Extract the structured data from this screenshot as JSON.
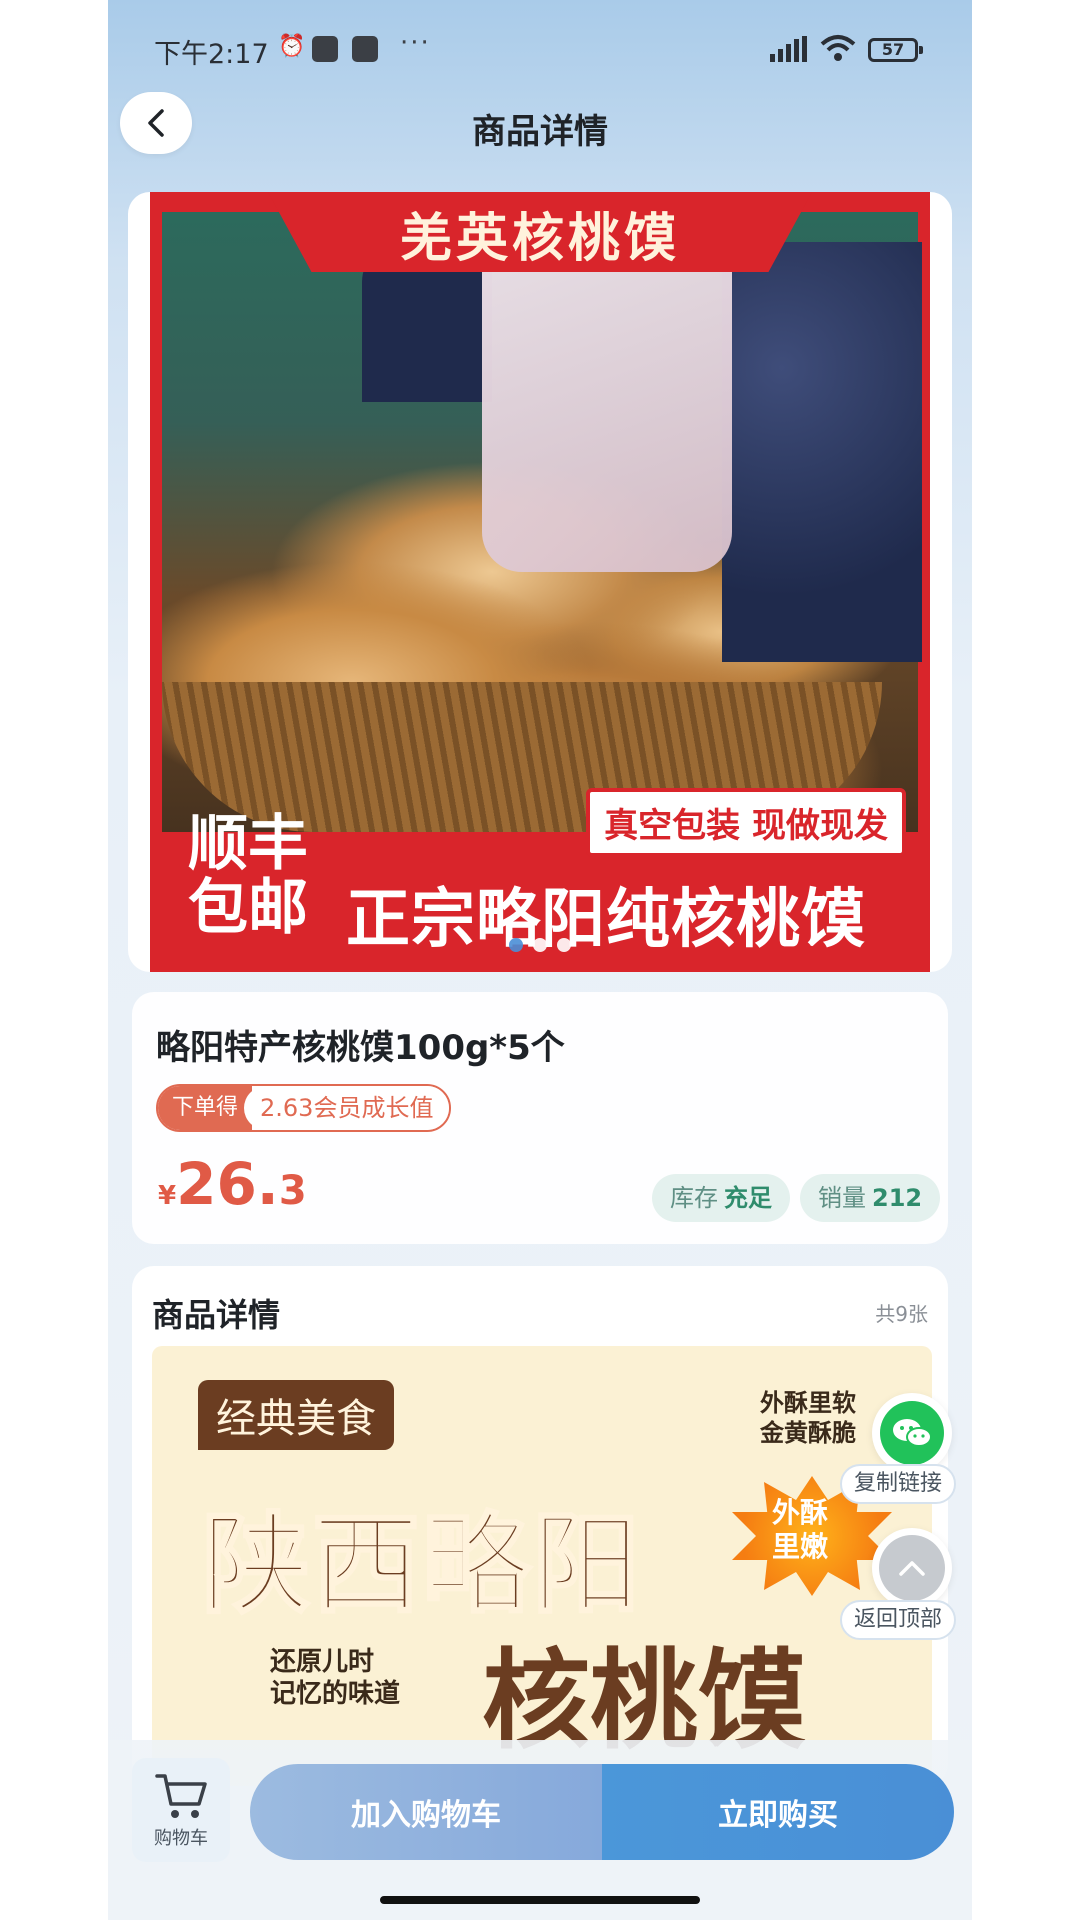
{
  "status_bar": {
    "time": "下午2:17",
    "battery": "57",
    "more": "···"
  },
  "header": {
    "title": "商品详情"
  },
  "hero": {
    "title": "羌英核桃馍",
    "tag": "真空包装 现做现发",
    "shipping": "顺丰包邮",
    "slogan": "正宗略阳纯核桃馍",
    "slide_count": 3,
    "active_slide": 1
  },
  "product": {
    "name": "略阳特产核桃馍100g*5个",
    "reward_label": "下单得",
    "reward_value": "2.63会员成长值",
    "currency": "¥",
    "price_int": "26.",
    "price_dec": "3",
    "stock_label": "库存",
    "stock_value": "充足",
    "sales_label": "销量",
    "sales_value": "212"
  },
  "detail": {
    "title": "商品详情",
    "count": "共9张",
    "poster": {
      "badge": "经典美食",
      "headline": "陕西略阳",
      "headline2": "核桃馍",
      "sub": "还原儿时\n记忆的味道",
      "corner": "外酥里软\n金黄酥脆",
      "burst": "外酥\n里嫩"
    }
  },
  "floating": {
    "copy_link": "复制链接",
    "back_top": "返回顶部"
  },
  "bottom": {
    "cart_label": "购物车",
    "add_to_cart": "加入购物车",
    "buy_now": "立即购买"
  },
  "colors": {
    "accent_red": "#e05a46",
    "brand_blue": "#4a8fd6",
    "wechat_green": "#21c25a"
  }
}
